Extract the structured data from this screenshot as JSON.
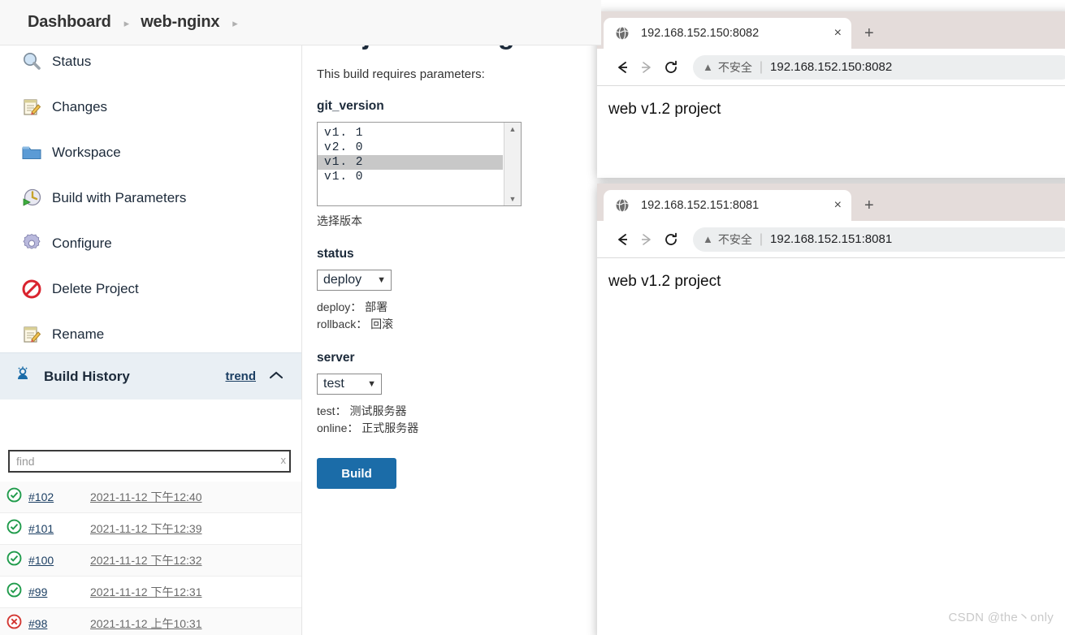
{
  "breadcrumb": {
    "items": [
      "Dashboard",
      "web-nginx"
    ],
    "separator": "▸"
  },
  "sidebar": {
    "items": [
      {
        "label": "Status",
        "icon": "magnifier-icon"
      },
      {
        "label": "Changes",
        "icon": "notepad-pencil-icon"
      },
      {
        "label": "Workspace",
        "icon": "folder-icon"
      },
      {
        "label": "Build with Parameters",
        "icon": "clock-play-icon"
      },
      {
        "label": "Configure",
        "icon": "gear-icon"
      },
      {
        "label": "Delete Project",
        "icon": "no-entry-icon"
      },
      {
        "label": "Rename",
        "icon": "notepad-pencil-icon"
      }
    ],
    "build_history": {
      "title": "Build History",
      "trend_label": "trend",
      "collapse_icon": "chevron-up-icon",
      "panel_icon": "build-history-icon",
      "find_placeholder": "find",
      "find_value": "",
      "clear_label": "x",
      "builds": [
        {
          "status": "success",
          "number": "#102",
          "date": "2021-11-12 下午12:40"
        },
        {
          "status": "success",
          "number": "#101",
          "date": "2021-11-12 下午12:39"
        },
        {
          "status": "success",
          "number": "#100",
          "date": "2021-11-12 下午12:32"
        },
        {
          "status": "success",
          "number": "#99",
          "date": "2021-11-12 下午12:31"
        },
        {
          "status": "failure",
          "number": "#98",
          "date": "2021-11-12 上午10:31"
        }
      ]
    }
  },
  "main": {
    "title": "Project web-nginx",
    "requires_text": "This build requires parameters:",
    "params": [
      {
        "name": "git_version",
        "type": "listbox",
        "options": [
          "v1. 1",
          "v2. 0",
          "v1. 2",
          "v1. 0"
        ],
        "selected": "v1. 2",
        "description": "选择版本"
      },
      {
        "name": "status",
        "type": "select",
        "value": "deploy",
        "description_lines": [
          "deploy： 部署",
          "rollback： 回滚"
        ]
      },
      {
        "name": "server",
        "type": "select",
        "value": "test",
        "description_lines": [
          "test： 测试服务器",
          "online： 正式服务器"
        ]
      }
    ],
    "build_button": "Build"
  },
  "browser_windows": [
    {
      "tab_title": "192.168.152.150:8082",
      "favicon": "globe-icon",
      "close_label": "×",
      "new_tab_label": "+",
      "back_label": "←",
      "forward_label": "→",
      "reload_label": "⟳",
      "security_warning": "不安全",
      "url": "192.168.152.150:8082",
      "page_text": "web v1.2 project"
    },
    {
      "tab_title": "192.168.152.151:8081",
      "favicon": "globe-icon",
      "close_label": "×",
      "new_tab_label": "+",
      "back_label": "←",
      "forward_label": "→",
      "reload_label": "⟳",
      "security_warning": "不安全",
      "url": "192.168.152.151:8081",
      "page_text": "web v1.2 project"
    }
  ],
  "watermark": "CSDN @the丶only",
  "colors": {
    "accent": "#1b6ca8",
    "success": "#1f9b4b",
    "failure": "#d33833",
    "panel": "#e9eff4",
    "tabstrip": "#e4dcda"
  }
}
